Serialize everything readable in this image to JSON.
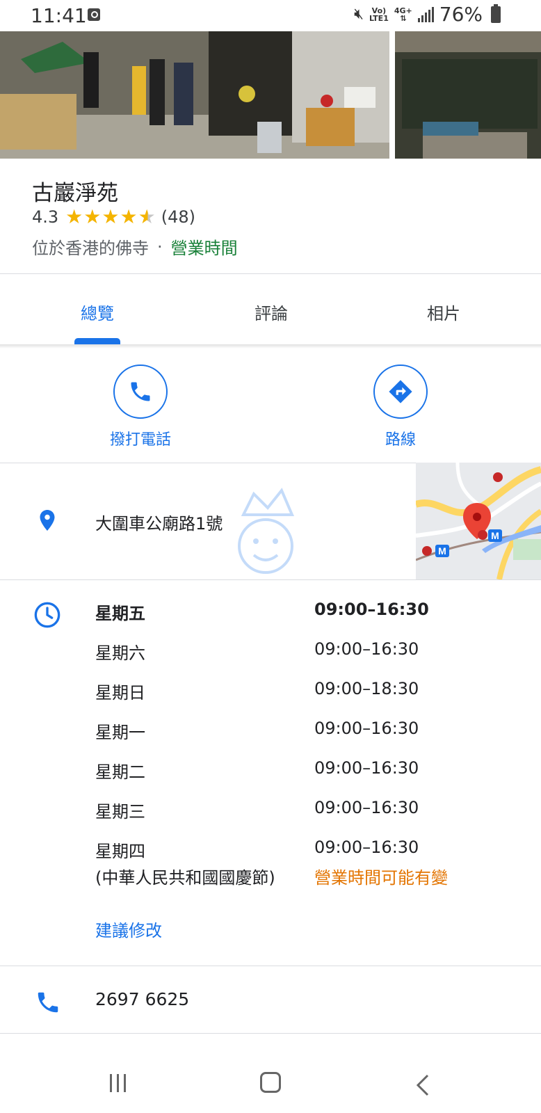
{
  "status_bar": {
    "time": "11:41",
    "network_top": "Vo)",
    "network_bottom": "LTE1",
    "data_top": "4G+",
    "battery": "76%"
  },
  "place": {
    "title": "古巖淨苑",
    "rating": "4.3",
    "stars": 4.3,
    "review_count": "(48)",
    "category": "位於香港的佛寺",
    "separator": "·",
    "hours_link": "營業時間"
  },
  "tabs": [
    {
      "label": "總覽",
      "active": true
    },
    {
      "label": "評論",
      "active": false
    },
    {
      "label": "相片",
      "active": false
    }
  ],
  "actions": {
    "call_label": "撥打電話",
    "route_label": "路線"
  },
  "address": "大圍車公廟路1號",
  "hours": [
    {
      "day": "星期五",
      "time": "09:00–16:30",
      "today": true
    },
    {
      "day": "星期六",
      "time": "09:00–16:30",
      "today": false
    },
    {
      "day": "星期日",
      "time": "09:00–18:30",
      "today": false
    },
    {
      "day": "星期一",
      "time": "09:00–16:30",
      "today": false
    },
    {
      "day": "星期二",
      "time": "09:00–16:30",
      "today": false
    },
    {
      "day": "星期三",
      "time": "09:00–16:30",
      "today": false
    },
    {
      "day": "星期四",
      "time": "09:00–16:30",
      "today": false
    }
  ],
  "holiday_note": "(中華人民共和國國慶節)",
  "holiday_warning": "營業時間可能有變",
  "suggest_edit": "建議修改",
  "phone": "2697 6625",
  "colors": {
    "accent": "#1a73e8",
    "open_green": "#188038",
    "warning_orange": "#e37400",
    "star": "#f4b400",
    "map_pin": "#ea4335"
  }
}
